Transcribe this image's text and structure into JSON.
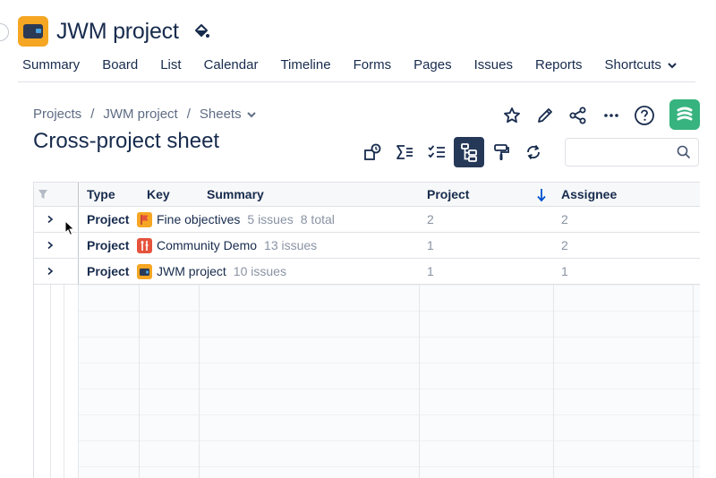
{
  "project": {
    "title": "JWM project"
  },
  "nav": {
    "items": [
      "Summary",
      "Board",
      "List",
      "Calendar",
      "Timeline",
      "Forms",
      "Pages",
      "Issues",
      "Reports",
      "Shortcuts"
    ]
  },
  "breadcrumbs": {
    "items": [
      "Projects",
      "JWM project",
      "Sheets"
    ]
  },
  "page": {
    "title": "Cross-project sheet"
  },
  "search": {
    "placeholder": ""
  },
  "table": {
    "headers": [
      "Type",
      "Key",
      "Summary",
      "Project",
      "Assignee"
    ],
    "rows": [
      {
        "type": "Project",
        "name": "Fine objectives",
        "issues": "5 issues",
        "total": "8 total",
        "project": "2",
        "assignee": "2",
        "icon_color": "#f5a623"
      },
      {
        "type": "Project",
        "name": "Community Demo",
        "issues": "13 issues",
        "total": "",
        "project": "1",
        "assignee": "2",
        "icon_color": "#e5533d"
      },
      {
        "type": "Project",
        "name": "JWM project",
        "issues": "10 issues",
        "total": "",
        "project": "1",
        "assignee": "1",
        "icon_color": "#f5a623"
      }
    ]
  },
  "icons": {
    "header": [
      "project-logo-icon",
      "paint-bucket-icon"
    ],
    "actions": [
      "star-icon",
      "pencil-icon",
      "share-icon",
      "more-icon",
      "help-icon",
      "app-logo-icon"
    ],
    "toolbar": [
      "view-shapes-icon",
      "sum-icon",
      "checklist-icon",
      "hierarchy-icon",
      "paint-roller-icon",
      "refresh-icon",
      "search-icon"
    ],
    "table": [
      "filter-icon",
      "sort-desc-icon",
      "chevron-right-icon"
    ]
  },
  "colors": {
    "accent": "#0052cc",
    "active_tool": "#253858",
    "app_logo": "#36b37e"
  }
}
